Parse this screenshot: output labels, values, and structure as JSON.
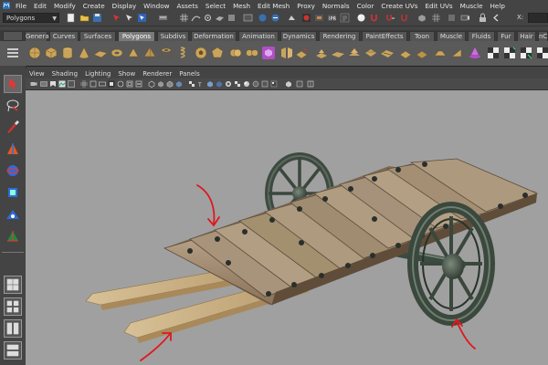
{
  "menubar": {
    "items": [
      "File",
      "Edit",
      "Modify",
      "Create",
      "Display",
      "Window",
      "Assets",
      "Select",
      "Mesh",
      "Edit Mesh",
      "Proxy",
      "Normals",
      "Color",
      "Create UVs",
      "Edit UVs",
      "Muscle",
      "Help"
    ]
  },
  "statusline": {
    "mode_value": "Polygons",
    "field_label": "X:"
  },
  "shelf": {
    "tabs": [
      "General",
      "Curves",
      "Surfaces",
      "Polygons",
      "Subdivs",
      "Deformation",
      "Animation",
      "Dynamics",
      "Rendering",
      "PaintEffects",
      "Toon",
      "Muscle",
      "Fluids",
      "Fur",
      "Hair",
      "nCloth"
    ],
    "active_tab": "Polygons"
  },
  "panel": {
    "menus": [
      "View",
      "Shading",
      "Lighting",
      "Show",
      "Renderer",
      "Panels"
    ]
  },
  "colors": {
    "viewport_bg": "#a0a0a0",
    "active_tab": "#7a7a7a",
    "annotation_red": "#e0171c"
  },
  "icons": {
    "select": "arrow-select-icon",
    "lasso": "lasso-icon",
    "paint": "paint-select-icon",
    "move": "move-icon",
    "rotate": "rotate-icon",
    "scale": "scale-icon",
    "manipulator": "universal-manip-icon",
    "soft_mod": "soft-mod-icon",
    "show_manip": "show-manip-icon",
    "layouts": "layout-icon"
  }
}
